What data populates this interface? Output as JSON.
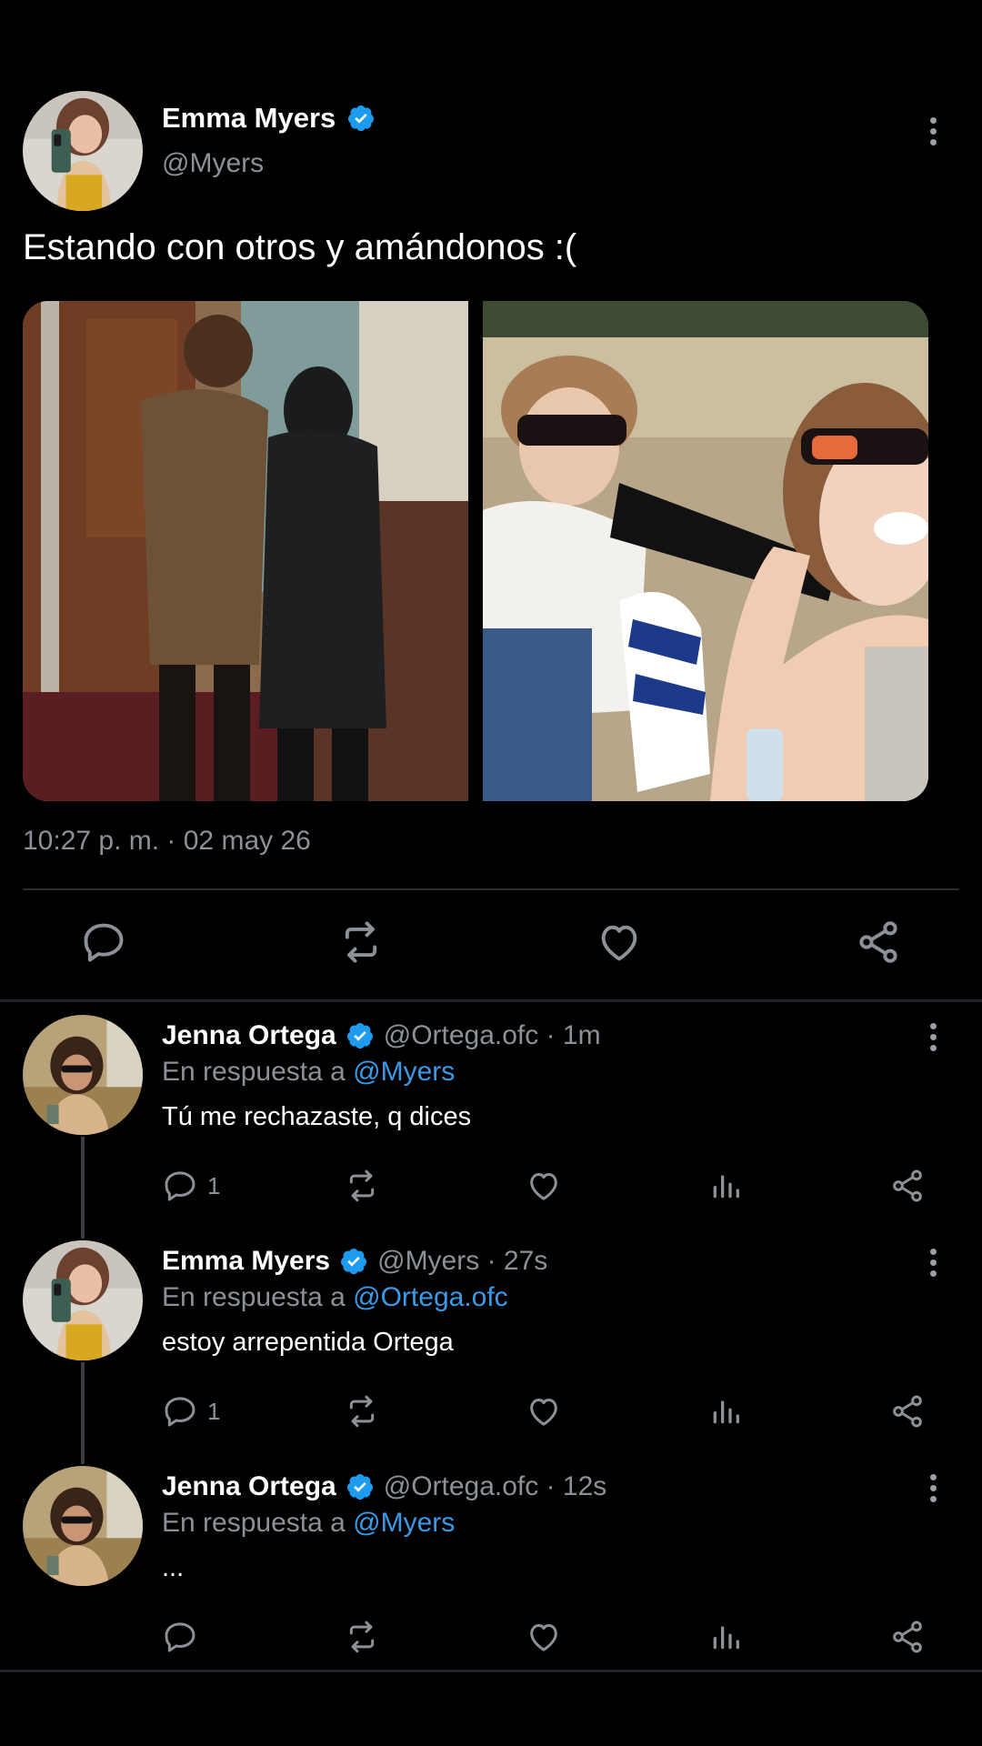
{
  "main_tweet": {
    "author_name": "Emma Myers",
    "author_handle": "@Myers",
    "text": "Estando con otros y amándonos :(",
    "timestamp": "10:27 p. m. · 02 may 26",
    "verified": true,
    "avatar_icon": "avatar-selfie-icon",
    "media": [
      "photo-1",
      "photo-2"
    ],
    "actions": [
      "reply-icon",
      "retweet-icon",
      "like-icon",
      "share-icon"
    ]
  },
  "replies": [
    {
      "author_name": "Jenna Ortega",
      "meta": "@Ortega.ofc · 1m",
      "context_prefix": "En respuesta a",
      "mention": "@Myers",
      "text": "Tú me rechazaste, q dices",
      "reply_count": "1"
    },
    {
      "author_name": "Emma Myers",
      "meta": "@Myers · 27s",
      "context_prefix": "En respuesta a",
      "mention": "@Ortega.ofc",
      "text": "estoy arrepentida Ortega",
      "reply_count": "1"
    },
    {
      "author_name": "Jenna Ortega",
      "meta": "@Ortega.ofc · 12s",
      "context_prefix": "En respuesta a",
      "mention": "@Myers",
      "text": "...",
      "reply_count": ""
    }
  ],
  "colors": {
    "background": "#000000",
    "text": "#ffffff",
    "secondary": "#8b9197",
    "link": "#3b9ae8",
    "verified": "#1d9bf0"
  }
}
